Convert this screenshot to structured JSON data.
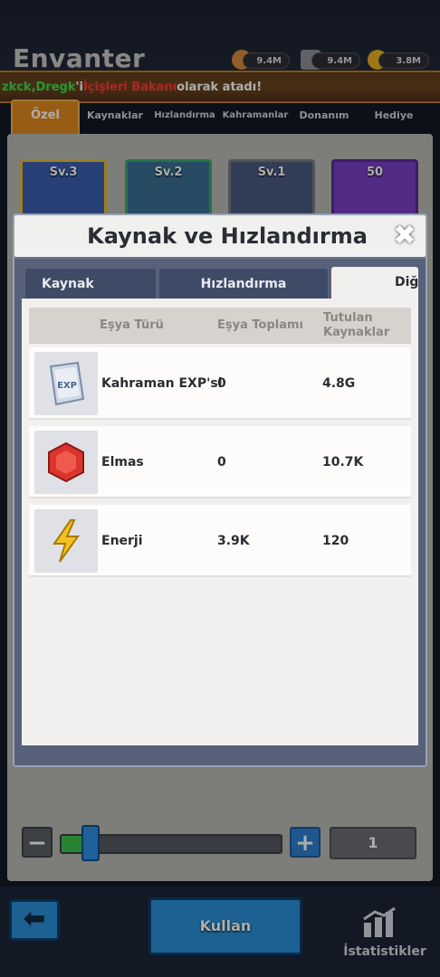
{
  "header": {
    "title": "Envanter",
    "resources": [
      {
        "icon": "scroll-icon",
        "value": "9.4M"
      },
      {
        "icon": "anvil-icon",
        "value": "9.4M"
      },
      {
        "icon": "gold-coin-icon",
        "value": "3.8M"
      }
    ]
  },
  "notice": {
    "part1": "zkck, ",
    "part2": "Dregk",
    "part3": "'i ",
    "part4": "İçişleri Bakanı",
    "part5": " olarak atadı!"
  },
  "inventory_tabs": [
    "Özel",
    "Kaynaklar",
    "Hızlandırma",
    "Kahramanlar",
    "Donanım",
    "Hediye"
  ],
  "item_cards": [
    {
      "label": "Sv.3",
      "color": "#e6b83a"
    },
    {
      "label": "Sv.2",
      "color": "#3aa86a"
    },
    {
      "label": "Sv.1",
      "color": "#7a7d82"
    },
    {
      "label": "50",
      "color": "#7b3fc4"
    }
  ],
  "modal": {
    "title": "Kaynak ve Hızlandırma",
    "tabs": [
      "Kaynak",
      "Hızlandırma",
      "Diğ"
    ],
    "columns": [
      "Eşya Türü",
      "Eşya Toplamı",
      "Tutulan Kaynaklar"
    ],
    "rows": [
      {
        "icon": "exp-book-icon",
        "name": "Kahraman EXP'si",
        "total": "0",
        "held": "4.8G"
      },
      {
        "icon": "red-gem-icon",
        "name": "Elmas",
        "total": "0",
        "held": "10.7K"
      },
      {
        "icon": "lightning-icon",
        "name": "Enerji",
        "total": "3.9K",
        "held": "120"
      }
    ]
  },
  "quantity": {
    "value": "1",
    "slider_fraction": 0.1
  },
  "bottom": {
    "use_label": "Kullan",
    "stats_label": "İstatistikler"
  }
}
